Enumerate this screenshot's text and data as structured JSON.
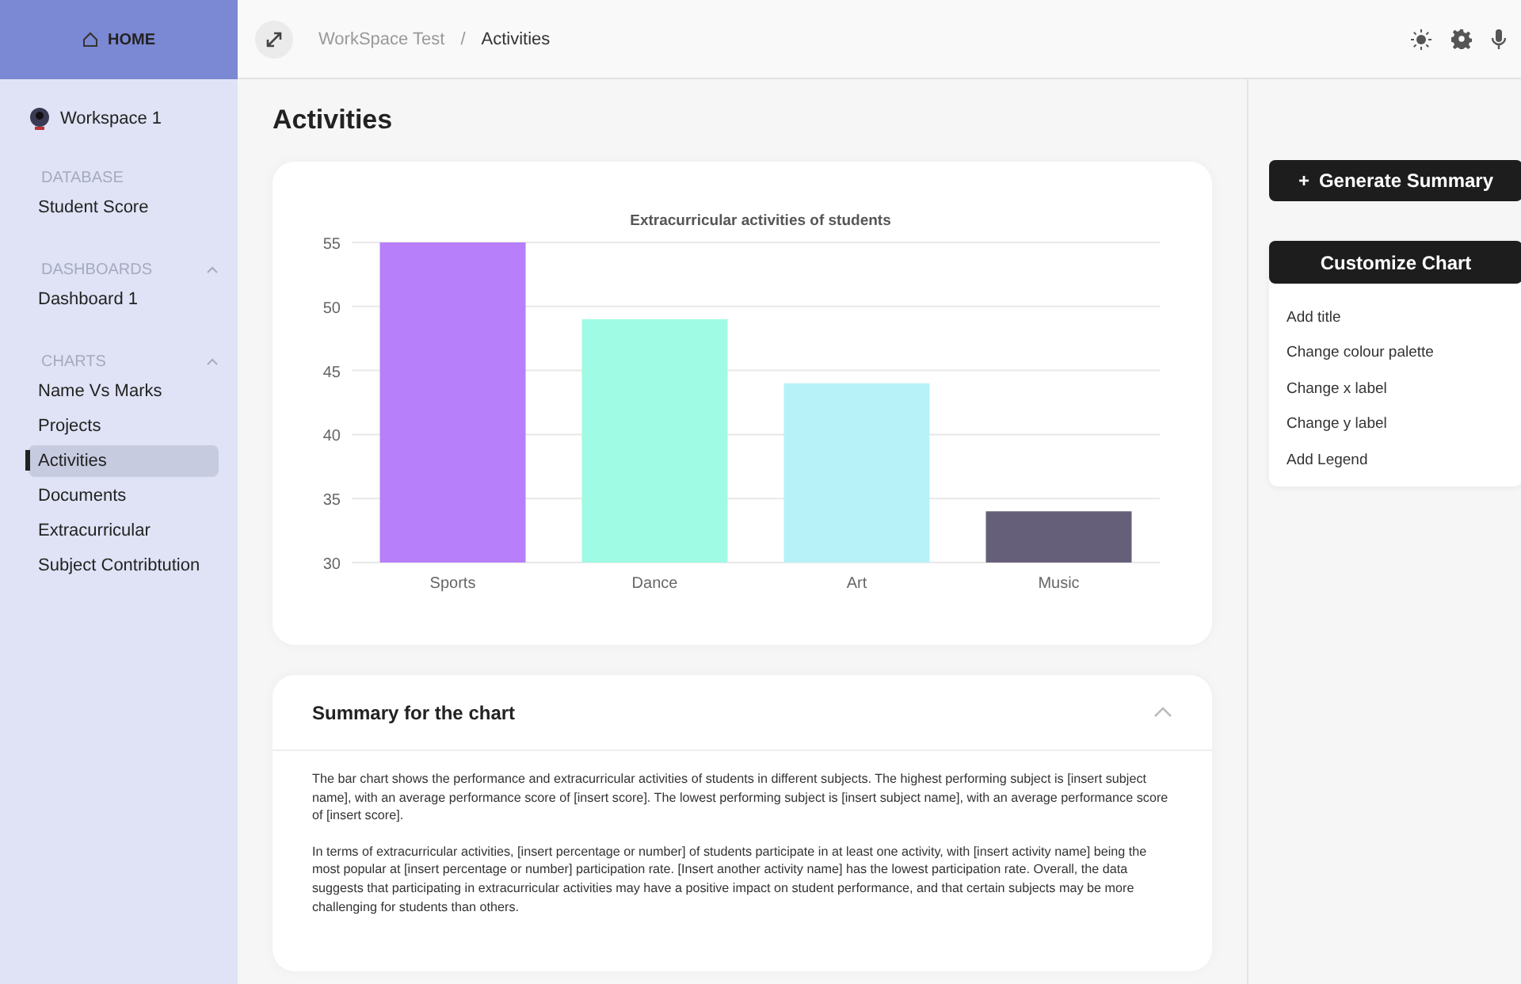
{
  "sidebar": {
    "home": "HOME",
    "workspace": "Workspace 1",
    "sections": [
      {
        "heading": "DATABASE",
        "kind": "static",
        "items": [
          {
            "label": "Student Score",
            "selected": false
          }
        ]
      },
      {
        "heading": "DASHBOARDS",
        "kind": "collapsible",
        "expanded": true,
        "items": [
          {
            "label": "Dashboard 1",
            "selected": false
          }
        ]
      },
      {
        "heading": "CHARTS",
        "kind": "collapsible",
        "expanded": true,
        "items": [
          {
            "label": "Name Vs Marks",
            "selected": false
          },
          {
            "label": "Projects",
            "selected": false
          },
          {
            "label": "Activities",
            "selected": true
          },
          {
            "label": "Documents",
            "selected": false
          },
          {
            "label": "Extracurricular",
            "selected": false
          },
          {
            "label": "Subject Contribtution",
            "selected": false
          }
        ]
      }
    ]
  },
  "breadcrumb": [
    "WorkSpace Test",
    "Activities"
  ],
  "breadcrumb_separator": "/",
  "page_title": "Activities",
  "chart": {
    "chart_data": {
      "type": "bar",
      "title": "Extracurricular activities of students",
      "categories": [
        "Sports",
        "Dance",
        "Art",
        "Music"
      ],
      "series": [
        {
          "color": "#b77ffa",
          "values": [
            55,
            null,
            null,
            null
          ]
        },
        {
          "color": "#9ffbe3",
          "values": [
            null,
            49,
            null,
            null
          ]
        },
        {
          "color": "#b8f2f9",
          "values": [
            null,
            null,
            44,
            null
          ]
        },
        {
          "color": "#665f7a",
          "values": [
            null,
            null,
            null,
            34
          ]
        }
      ],
      "stacked": true,
      "grid": true,
      "ylim": [
        30,
        55
      ],
      "yticks": [
        30,
        35,
        40,
        45,
        50,
        55
      ]
    }
  },
  "summary": {
    "title": "Summary for the chart",
    "expanded": true,
    "paragraphs": [
      "The bar chart shows the performance and extracurricular activities of students in different subjects. The highest performing subject is [insert subject name], with an average performance score of [insert score]. The lowest performing subject is [insert subject name], with an average performance score of [insert score].",
      "In terms of extracurricular activities, [insert percentage or number] of students participate in at least one activity, with [insert activity name] being the most popular at [insert percentage or number] participation rate. [Insert another activity name] has the lowest participation rate. Overall, the data suggests that participating in extracurricular activities may have a positive impact on student performance, and that certain subjects may be more challenging for students than others."
    ]
  },
  "right_panel": {
    "generate_button": {
      "icon": "+",
      "label": "Generate Summary"
    },
    "customize": {
      "title": "Customize Chart",
      "items": [
        "Add title",
        "Change colour palette",
        "Change x label",
        "Change y label",
        "Add Legend"
      ]
    }
  }
}
